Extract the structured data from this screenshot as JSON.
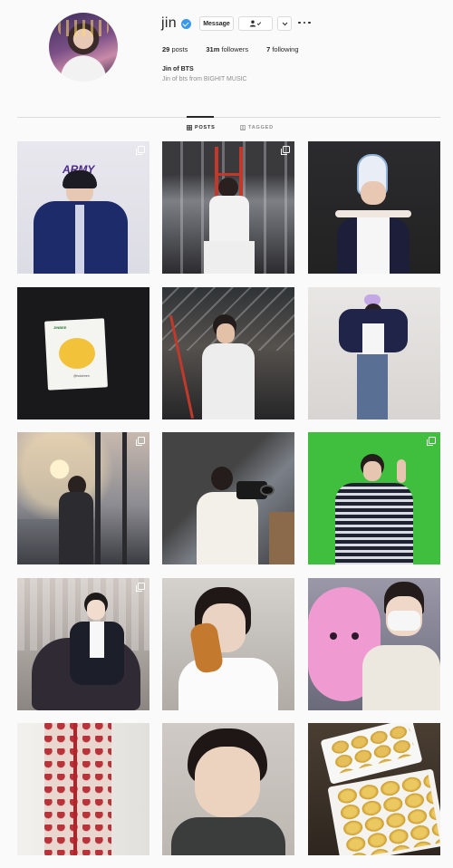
{
  "profile": {
    "username": "jin",
    "verified": true,
    "buttons": {
      "message": "Message"
    },
    "stats": [
      {
        "count": "29",
        "label": "posts"
      },
      {
        "count": "31m",
        "label": "followers"
      },
      {
        "count": "7",
        "label": "following"
      }
    ],
    "bio_name": "Jin of BTS",
    "bio_text": "Jin of bts from BIGHIT MUSIC"
  },
  "tabs": [
    {
      "label": "POSTS",
      "active": true
    },
    {
      "label": "TAGGED",
      "active": false
    }
  ],
  "posts": [
    {
      "id": "post-1",
      "multi": true,
      "sign_text": "ARMY"
    },
    {
      "id": "post-2",
      "multi": true
    },
    {
      "id": "post-3",
      "multi": false
    },
    {
      "id": "post-4",
      "multi": false,
      "sticker_text": "JINBEE",
      "caption_text": "@tvdaimen"
    },
    {
      "id": "post-5",
      "multi": false
    },
    {
      "id": "post-6",
      "multi": false
    },
    {
      "id": "post-7",
      "multi": true
    },
    {
      "id": "post-8",
      "multi": false
    },
    {
      "id": "post-9",
      "multi": true
    },
    {
      "id": "post-10",
      "multi": true
    },
    {
      "id": "post-11",
      "multi": false
    },
    {
      "id": "post-12",
      "multi": false
    },
    {
      "id": "post-13",
      "multi": false
    },
    {
      "id": "post-14",
      "multi": false
    },
    {
      "id": "post-15",
      "multi": false
    }
  ],
  "colors": {
    "verified": "#3897f0",
    "text": "#262626",
    "muted": "#8e8e8e",
    "border": "#dbdbdb"
  }
}
